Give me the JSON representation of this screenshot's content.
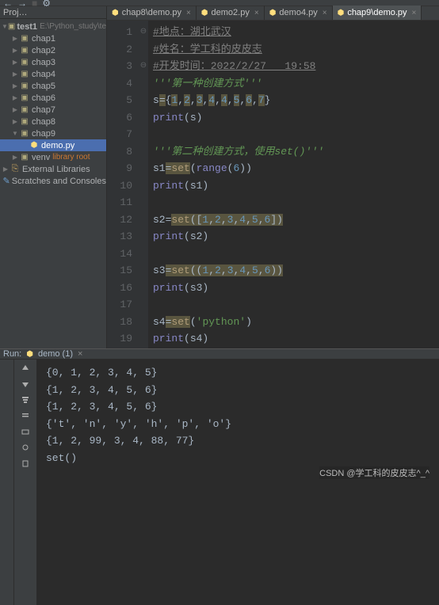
{
  "toolbar": {},
  "project_panel": {
    "title": "Proj…",
    "root_name": "test1",
    "root_path": "E:\\Python_study\\te",
    "items": [
      {
        "label": "chap1",
        "type": "folder",
        "depth": 1,
        "arrow": "▶"
      },
      {
        "label": "chap2",
        "type": "folder",
        "depth": 1,
        "arrow": "▶"
      },
      {
        "label": "chap3",
        "type": "folder",
        "depth": 1,
        "arrow": "▶"
      },
      {
        "label": "chap4",
        "type": "folder",
        "depth": 1,
        "arrow": "▶"
      },
      {
        "label": "chap5",
        "type": "folder",
        "depth": 1,
        "arrow": "▶"
      },
      {
        "label": "chap6",
        "type": "folder",
        "depth": 1,
        "arrow": "▶"
      },
      {
        "label": "chap7",
        "type": "folder",
        "depth": 1,
        "arrow": "▶"
      },
      {
        "label": "chap8",
        "type": "folder",
        "depth": 1,
        "arrow": "▶"
      },
      {
        "label": "chap9",
        "type": "folder",
        "depth": 1,
        "arrow": "▼"
      },
      {
        "label": "demo.py",
        "type": "file",
        "depth": 2,
        "selected": true
      },
      {
        "label": "venv",
        "type": "folder",
        "depth": 1,
        "arrow": "▶",
        "suffix": "library root"
      },
      {
        "label": "External Libraries",
        "type": "lib",
        "depth": 0,
        "arrow": "▶"
      },
      {
        "label": "Scratches and Consoles",
        "type": "scratch",
        "depth": 0
      }
    ]
  },
  "tabs": [
    {
      "label": "chap8\\demo.py",
      "active": false
    },
    {
      "label": "demo2.py",
      "active": false
    },
    {
      "label": "demo4.py",
      "active": false
    },
    {
      "label": "chap9\\demo.py",
      "active": true
    }
  ],
  "code": {
    "lines": [
      {
        "n": 1,
        "mark": "⊖",
        "html": "<span class='c-comment u'>#地点：湖北武汉</span>"
      },
      {
        "n": 2,
        "mark": "",
        "html": "<span class='c-comment u'>#姓名：学工科的皮皮志</span>"
      },
      {
        "n": 3,
        "mark": "⊖",
        "html": "<span class='c-comment u'>#开发时间：2022/2/27   19:58</span>"
      },
      {
        "n": 4,
        "mark": "",
        "html": "<span class='c-dstr'>'''第一种创建方式'''</span>"
      },
      {
        "n": 5,
        "mark": "",
        "html": "s<span class='hl-bg'>=</span>{<span class='c-num hl-bg'>1</span>,<span class='c-num hl-bg'>2</span>,<span class='c-num hl-bg'>3</span>,<span class='c-num hl-bg'>4</span>,<span class='c-num hl-bg'>4</span>,<span class='c-num hl-bg'>5</span>,<span class='c-num hl-bg'>6</span>,<span class='c-num hl-bg'>7</span>}"
      },
      {
        "n": 6,
        "mark": "",
        "html": "<span class='c-builtin'>print</span>(s)"
      },
      {
        "n": 7,
        "mark": "",
        "html": ""
      },
      {
        "n": 8,
        "mark": "",
        "html": "<span class='c-dstr'>'''第二种创建方式，使用set()'''</span>"
      },
      {
        "n": 9,
        "mark": "",
        "html": "s1<span class='hl-bg'>=</span><span class='c-call hl-bg'>set</span>(<span class='c-builtin'>range</span>(<span class='c-num'>6</span>))"
      },
      {
        "n": 10,
        "mark": "",
        "html": "<span class='c-builtin'>print</span>(s1)"
      },
      {
        "n": 11,
        "mark": "",
        "html": ""
      },
      {
        "n": 12,
        "mark": "",
        "html": "s2=<span class='c-call hl-bg'>set</span><span class='hl-bg'>([</span><span class='c-num hl-bg'>1</span><span class='hl-bg'>,</span><span class='c-num hl-bg'>2</span><span class='hl-bg'>,</span><span class='c-num hl-bg'>3</span><span class='hl-bg'>,</span><span class='c-num hl-bg'>4</span><span class='hl-bg'>,</span><span class='c-num hl-bg'>5</span><span class='hl-bg'>,</span><span class='c-num hl-bg'>6</span><span class='hl-bg'>])</span>"
      },
      {
        "n": 13,
        "mark": "",
        "html": "<span class='c-builtin'>print</span>(s2)"
      },
      {
        "n": 14,
        "mark": "",
        "html": ""
      },
      {
        "n": 15,
        "mark": "",
        "html": "s3<span class='hl-bg'>=</span><span class='c-call hl-bg'>set</span><span class='hl-bg'>((</span><span class='c-num hl-bg'>1</span><span class='hl-bg'>,</span><span class='c-num hl-bg'>2</span><span class='hl-bg'>,</span><span class='c-num hl-bg'>3</span><span class='hl-bg'>,</span><span class='c-num hl-bg'>4</span><span class='hl-bg'>,</span><span class='c-num hl-bg'>5</span><span class='hl-bg'>,</span><span class='c-num hl-bg'>6</span><span class='hl-bg'>))</span>"
      },
      {
        "n": 16,
        "mark": "",
        "html": "<span class='c-builtin'>print</span>(s3)"
      },
      {
        "n": 17,
        "mark": "",
        "html": ""
      },
      {
        "n": 18,
        "mark": "",
        "html": "s4<span class='hl-bg'>=</span><span class='c-call hl-bg'>set</span>(<span class='c-str'>'python'</span>)"
      },
      {
        "n": 19,
        "mark": "",
        "html": "<span class='c-builtin'>print</span>(s4)"
      }
    ]
  },
  "run": {
    "label": "Run:",
    "config": "demo (1)",
    "suffix": "×",
    "output": [
      "{0, 1, 2, 3, 4, 5}",
      "{1, 2, 3, 4, 5, 6}",
      "{1, 2, 3, 4, 5, 6}",
      "{'t', 'n', 'y', 'h', 'p', 'o'}",
      "{1, 2, 99, 3, 4, 88, 77}",
      "set()"
    ]
  },
  "watermark": "CSDN @学工科的皮皮志^_^"
}
